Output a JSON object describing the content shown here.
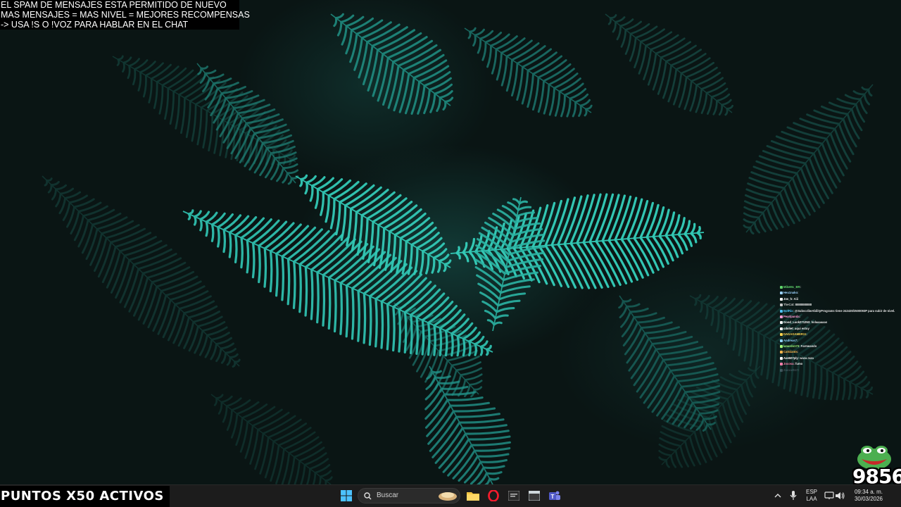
{
  "banner": {
    "line1": "EL SPAM DE MENSAJES ESTA PERMITIDO DE NUEVO",
    "line2": "MAS MENSAJES = MAS NIVEL = MEJORES RECOMPENSAS",
    "line3": "-> USA !S  O !VOZ PARA HABLAR EN EL CHAT"
  },
  "chat": {
    "messages": [
      {
        "user": "MikeMc_BR",
        "text": ": ",
        "color": "#5fd36b"
      },
      {
        "user": "Heu1nako",
        "text": ": ",
        "color": "#9bd3ff"
      },
      {
        "user": "Jos_h",
        "text": ": Aiii",
        "color": "#ffffff"
      },
      {
        "user": "TheCat",
        "text": ": 8888888888",
        "color": "#c9c9c9"
      },
      {
        "user": "BotRix",
        "text": ": @SubscribeAbilityPrograms tiene 242430/2500093P para subir de nivel.",
        "color": "#4fc3f7"
      },
      {
        "user": "Pearlpanda",
        "text": ": ",
        "color": "#ff9ad5"
      },
      {
        "user": "Good_Luck271253",
        "text": ": holaaaaaas",
        "color": "#ffffff"
      },
      {
        "user": "cdoliet",
        "text": ": aqui estoy",
        "color": "#ffffff"
      },
      {
        "user": "DAGAGAMER11",
        "text": ": ",
        "color": "#ffd54f"
      },
      {
        "user": "Andreas7",
        "text": ": ",
        "color": "#8fd3ff"
      },
      {
        "user": "lanardo173",
        "text": ": Farmeando",
        "color": "#a5ff7a"
      },
      {
        "user": "CatGiants",
        "text": ": ",
        "color": "#ffb74d"
      },
      {
        "user": "Axe507ply",
        "text": ": waza raza",
        "color": "#ffffff"
      },
      {
        "user": "Jocosa",
        "text": ": fumo",
        "color": "#ff80ab"
      },
      {
        "user": "ZaxxarE47",
        "text": ": ",
        "color": "#7e8fa0"
      }
    ]
  },
  "overlay": {
    "counter": "9856",
    "points": "PUNTOS X50 ACTIVOS"
  },
  "taskbar": {
    "search_placeholder": "Buscar",
    "lang_line1": "ESP",
    "lang_line2": "LAA",
    "time": "09:34 a. m.",
    "date": "30/03/2026"
  }
}
